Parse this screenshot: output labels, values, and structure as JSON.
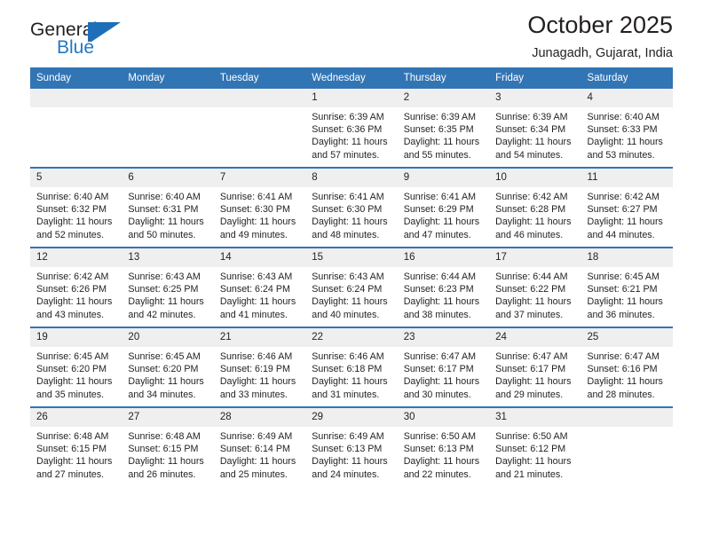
{
  "brand": {
    "name_top": "General",
    "name_bottom": "Blue",
    "mark": "blue-triangle-logo",
    "color_top": "#231f20",
    "color_bottom": "#2079c4"
  },
  "header": {
    "title": "October 2025",
    "subtitle": "Junagadh, Gujarat, India"
  },
  "theme": {
    "header_blue": "#3275b4",
    "daynum_band": "#efefef",
    "text": "#231f20"
  },
  "weekdays": [
    "Sunday",
    "Monday",
    "Tuesday",
    "Wednesday",
    "Thursday",
    "Friday",
    "Saturday"
  ],
  "weeks": [
    [
      {
        "empty": true
      },
      {
        "empty": true
      },
      {
        "empty": true
      },
      {
        "day": "1",
        "sunrise": "Sunrise: 6:39 AM",
        "sunset": "Sunset: 6:36 PM",
        "daylight_1": "Daylight: 11 hours",
        "daylight_2": "and 57 minutes."
      },
      {
        "day": "2",
        "sunrise": "Sunrise: 6:39 AM",
        "sunset": "Sunset: 6:35 PM",
        "daylight_1": "Daylight: 11 hours",
        "daylight_2": "and 55 minutes."
      },
      {
        "day": "3",
        "sunrise": "Sunrise: 6:39 AM",
        "sunset": "Sunset: 6:34 PM",
        "daylight_1": "Daylight: 11 hours",
        "daylight_2": "and 54 minutes."
      },
      {
        "day": "4",
        "sunrise": "Sunrise: 6:40 AM",
        "sunset": "Sunset: 6:33 PM",
        "daylight_1": "Daylight: 11 hours",
        "daylight_2": "and 53 minutes."
      }
    ],
    [
      {
        "day": "5",
        "sunrise": "Sunrise: 6:40 AM",
        "sunset": "Sunset: 6:32 PM",
        "daylight_1": "Daylight: 11 hours",
        "daylight_2": "and 52 minutes."
      },
      {
        "day": "6",
        "sunrise": "Sunrise: 6:40 AM",
        "sunset": "Sunset: 6:31 PM",
        "daylight_1": "Daylight: 11 hours",
        "daylight_2": "and 50 minutes."
      },
      {
        "day": "7",
        "sunrise": "Sunrise: 6:41 AM",
        "sunset": "Sunset: 6:30 PM",
        "daylight_1": "Daylight: 11 hours",
        "daylight_2": "and 49 minutes."
      },
      {
        "day": "8",
        "sunrise": "Sunrise: 6:41 AM",
        "sunset": "Sunset: 6:30 PM",
        "daylight_1": "Daylight: 11 hours",
        "daylight_2": "and 48 minutes."
      },
      {
        "day": "9",
        "sunrise": "Sunrise: 6:41 AM",
        "sunset": "Sunset: 6:29 PM",
        "daylight_1": "Daylight: 11 hours",
        "daylight_2": "and 47 minutes."
      },
      {
        "day": "10",
        "sunrise": "Sunrise: 6:42 AM",
        "sunset": "Sunset: 6:28 PM",
        "daylight_1": "Daylight: 11 hours",
        "daylight_2": "and 46 minutes."
      },
      {
        "day": "11",
        "sunrise": "Sunrise: 6:42 AM",
        "sunset": "Sunset: 6:27 PM",
        "daylight_1": "Daylight: 11 hours",
        "daylight_2": "and 44 minutes."
      }
    ],
    [
      {
        "day": "12",
        "sunrise": "Sunrise: 6:42 AM",
        "sunset": "Sunset: 6:26 PM",
        "daylight_1": "Daylight: 11 hours",
        "daylight_2": "and 43 minutes."
      },
      {
        "day": "13",
        "sunrise": "Sunrise: 6:43 AM",
        "sunset": "Sunset: 6:25 PM",
        "daylight_1": "Daylight: 11 hours",
        "daylight_2": "and 42 minutes."
      },
      {
        "day": "14",
        "sunrise": "Sunrise: 6:43 AM",
        "sunset": "Sunset: 6:24 PM",
        "daylight_1": "Daylight: 11 hours",
        "daylight_2": "and 41 minutes."
      },
      {
        "day": "15",
        "sunrise": "Sunrise: 6:43 AM",
        "sunset": "Sunset: 6:24 PM",
        "daylight_1": "Daylight: 11 hours",
        "daylight_2": "and 40 minutes."
      },
      {
        "day": "16",
        "sunrise": "Sunrise: 6:44 AM",
        "sunset": "Sunset: 6:23 PM",
        "daylight_1": "Daylight: 11 hours",
        "daylight_2": "and 38 minutes."
      },
      {
        "day": "17",
        "sunrise": "Sunrise: 6:44 AM",
        "sunset": "Sunset: 6:22 PM",
        "daylight_1": "Daylight: 11 hours",
        "daylight_2": "and 37 minutes."
      },
      {
        "day": "18",
        "sunrise": "Sunrise: 6:45 AM",
        "sunset": "Sunset: 6:21 PM",
        "daylight_1": "Daylight: 11 hours",
        "daylight_2": "and 36 minutes."
      }
    ],
    [
      {
        "day": "19",
        "sunrise": "Sunrise: 6:45 AM",
        "sunset": "Sunset: 6:20 PM",
        "daylight_1": "Daylight: 11 hours",
        "daylight_2": "and 35 minutes."
      },
      {
        "day": "20",
        "sunrise": "Sunrise: 6:45 AM",
        "sunset": "Sunset: 6:20 PM",
        "daylight_1": "Daylight: 11 hours",
        "daylight_2": "and 34 minutes."
      },
      {
        "day": "21",
        "sunrise": "Sunrise: 6:46 AM",
        "sunset": "Sunset: 6:19 PM",
        "daylight_1": "Daylight: 11 hours",
        "daylight_2": "and 33 minutes."
      },
      {
        "day": "22",
        "sunrise": "Sunrise: 6:46 AM",
        "sunset": "Sunset: 6:18 PM",
        "daylight_1": "Daylight: 11 hours",
        "daylight_2": "and 31 minutes."
      },
      {
        "day": "23",
        "sunrise": "Sunrise: 6:47 AM",
        "sunset": "Sunset: 6:17 PM",
        "daylight_1": "Daylight: 11 hours",
        "daylight_2": "and 30 minutes."
      },
      {
        "day": "24",
        "sunrise": "Sunrise: 6:47 AM",
        "sunset": "Sunset: 6:17 PM",
        "daylight_1": "Daylight: 11 hours",
        "daylight_2": "and 29 minutes."
      },
      {
        "day": "25",
        "sunrise": "Sunrise: 6:47 AM",
        "sunset": "Sunset: 6:16 PM",
        "daylight_1": "Daylight: 11 hours",
        "daylight_2": "and 28 minutes."
      }
    ],
    [
      {
        "day": "26",
        "sunrise": "Sunrise: 6:48 AM",
        "sunset": "Sunset: 6:15 PM",
        "daylight_1": "Daylight: 11 hours",
        "daylight_2": "and 27 minutes."
      },
      {
        "day": "27",
        "sunrise": "Sunrise: 6:48 AM",
        "sunset": "Sunset: 6:15 PM",
        "daylight_1": "Daylight: 11 hours",
        "daylight_2": "and 26 minutes."
      },
      {
        "day": "28",
        "sunrise": "Sunrise: 6:49 AM",
        "sunset": "Sunset: 6:14 PM",
        "daylight_1": "Daylight: 11 hours",
        "daylight_2": "and 25 minutes."
      },
      {
        "day": "29",
        "sunrise": "Sunrise: 6:49 AM",
        "sunset": "Sunset: 6:13 PM",
        "daylight_1": "Daylight: 11 hours",
        "daylight_2": "and 24 minutes."
      },
      {
        "day": "30",
        "sunrise": "Sunrise: 6:50 AM",
        "sunset": "Sunset: 6:13 PM",
        "daylight_1": "Daylight: 11 hours",
        "daylight_2": "and 22 minutes."
      },
      {
        "day": "31",
        "sunrise": "Sunrise: 6:50 AM",
        "sunset": "Sunset: 6:12 PM",
        "daylight_1": "Daylight: 11 hours",
        "daylight_2": "and 21 minutes."
      },
      {
        "empty": true
      }
    ]
  ]
}
